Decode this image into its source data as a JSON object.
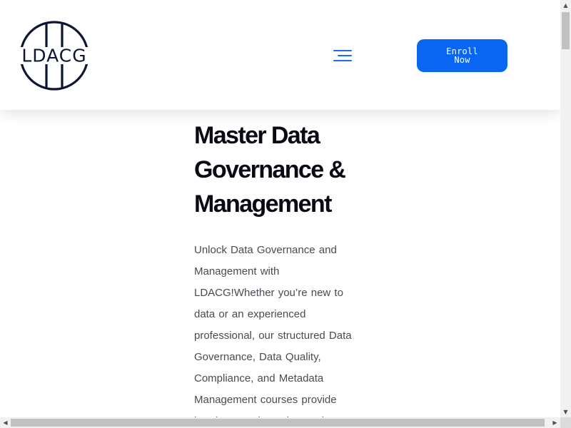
{
  "header": {
    "logo_text": "LDACG",
    "enroll_label": "Enroll Now",
    "menu_icon": "hamburger-menu-icon"
  },
  "hero": {
    "title": "Master Data Governance & Management",
    "description": "Unlock Data Governance and Management with LDACG!Whether you’re new to data or an experienced professional, our structured Data Governance, Data Quality, Compliance, and Metadata Management courses provide hands-on projects, interactive"
  },
  "colors": {
    "accent": "#0866f2",
    "logo": "#0d1533",
    "title": "#0a0a14",
    "body_text": "#4a4a52"
  },
  "scrollbars": {
    "up_icon": "triangle-up-icon",
    "down_icon": "triangle-down-icon",
    "left_icon": "triangle-left-icon",
    "right_icon": "triangle-right-icon"
  }
}
